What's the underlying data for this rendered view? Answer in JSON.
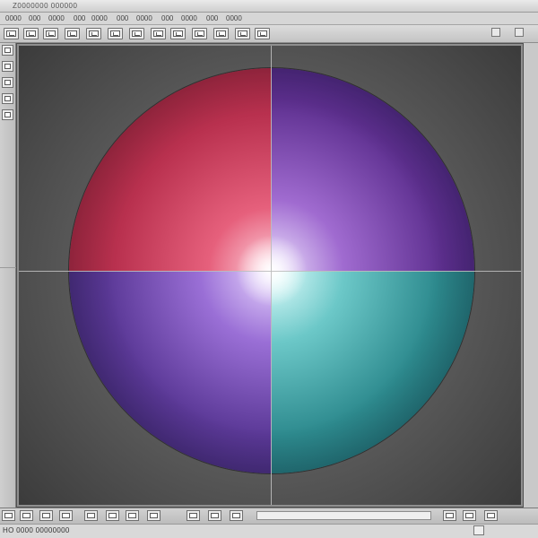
{
  "window": {
    "title": "Z0000000 000000",
    "status": "HO 0000 00000000"
  },
  "menu": [
    {
      "label": "0000"
    },
    {
      "label": "000"
    },
    {
      "label": "0000"
    },
    {
      "label": "000"
    },
    {
      "label": "0000"
    },
    {
      "label": "000"
    },
    {
      "label": "0000"
    },
    {
      "label": "000"
    },
    {
      "label": "0000"
    },
    {
      "label": "000"
    },
    {
      "label": "0000"
    }
  ],
  "colors": {
    "quadrant_top_left": "#b8304e",
    "quadrant_top_right": "#5d2f8f",
    "quadrant_bottom_left": "#5a3896",
    "quadrant_bottom_right": "#2d8a8e",
    "viewport_bg": "#5a5a5a"
  },
  "icons": {
    "toolbar": [
      "layer-icon",
      "layer-icon",
      "layer-icon",
      "layer-icon",
      "layer-icon",
      "layer-icon",
      "layer-icon",
      "layer-icon",
      "layer-icon",
      "layer-icon",
      "layer-icon",
      "layer-icon"
    ],
    "tools": [
      "tool-icon",
      "tool-icon",
      "tool-icon",
      "tool-icon",
      "tool-icon"
    ],
    "bottom": [
      "frame-icon",
      "frame-icon",
      "frame-icon",
      "frame-icon",
      "frame-icon",
      "frame-icon",
      "frame-icon",
      "frame-icon",
      "frame-icon",
      "frame-icon",
      "frame-icon"
    ]
  }
}
